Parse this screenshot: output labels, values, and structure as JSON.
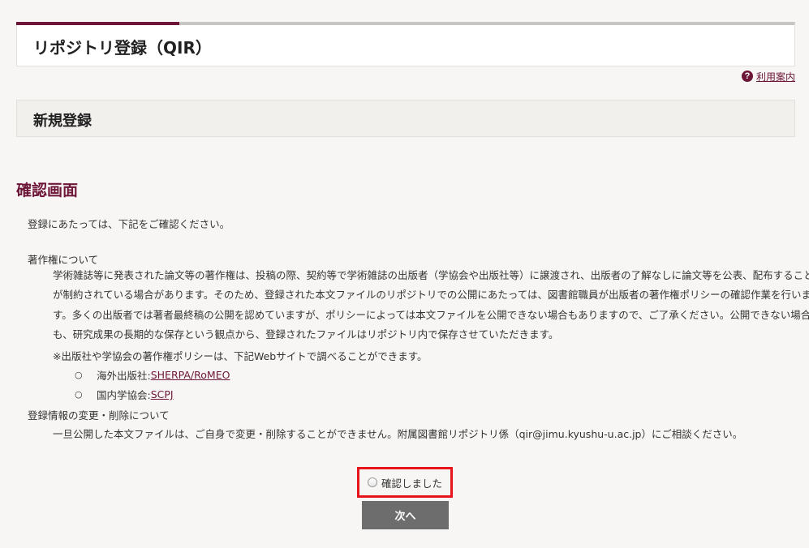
{
  "header": {
    "title": "リポジトリ登録（QIR）",
    "help_icon_glyph": "?",
    "help_link": "利用案内"
  },
  "subheader": {
    "title": "新規登録"
  },
  "section": {
    "heading": "確認画面",
    "intro": "登録にあたっては、下記をご確認ください。"
  },
  "copyright": {
    "title": "著作権について",
    "lines": [
      "学術雑誌等に発表された論文等の著作権は、投稿の際、契約等で学術雑誌の出版者（学協会や出版社等）に譲渡され、出版者の了解なしに論文等を公表、配布すること等",
      "が制約されている場合があります。そのため、登録された本文ファイルのリポジトリでの公開にあたっては、図書館職員が出版者の著作権ポリシーの確認作業を行いま",
      "す。多くの出版者では著者最終稿の公開を認めていますが、ポリシーによっては本文ファイルを公開できない場合もありますので、ご了承ください。公開できない場合で",
      "も、研究成果の長期的な保存という観点から、登録されたファイルはリポジトリ内で保存させていただきます。"
    ],
    "note": "※出版社や学協会の著作権ポリシーは、下記Webサイトで調べることができます。",
    "links": [
      {
        "label": "海外出版社: ",
        "link_text": "SHERPA/RoMEO"
      },
      {
        "label": "国内学協会: ",
        "link_text": "SCPJ"
      }
    ]
  },
  "change": {
    "title": "登録情報の変更・削除について",
    "text": "一旦公開した本文ファイルは、ご自身で変更・削除することができません。附属図書館リポジトリ係（qir@jimu.kyushu-u.ac.jp）にご相談ください。"
  },
  "form": {
    "confirm_label": "確認しました",
    "next_button": "次へ"
  },
  "bullet_glyph": "○",
  "colors": {
    "accent": "#6d1638",
    "highlight_border": "#e8141c",
    "button": "#6d6d6d"
  }
}
